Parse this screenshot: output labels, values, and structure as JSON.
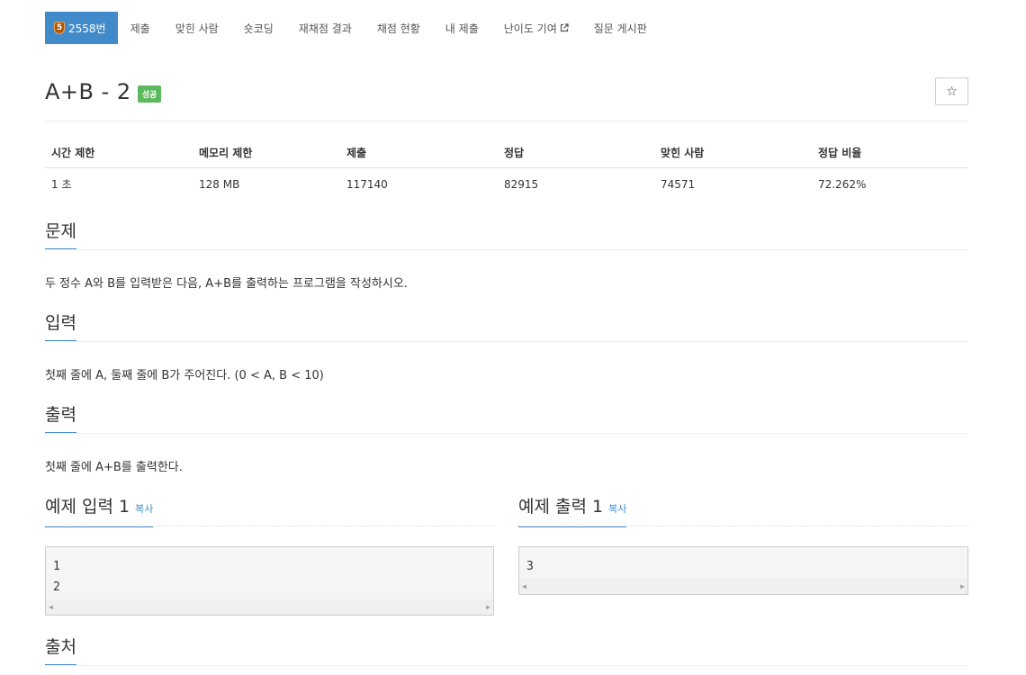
{
  "nav": {
    "problem_tier": "5",
    "problem_number": "2558번",
    "tabs": [
      "제출",
      "맞힌 사람",
      "숏코딩",
      "재채점 결과",
      "채점 현황",
      "내 제출",
      "난이도 기여",
      "질문 게시판"
    ]
  },
  "problem": {
    "title": "A+B - 2",
    "status_badge": "성공",
    "star_icon": "☆"
  },
  "info_table": {
    "headers": [
      "시간 제한",
      "메모리 제한",
      "제출",
      "정답",
      "맞힌 사람",
      "정답 비율"
    ],
    "values": [
      "1 초",
      "128 MB",
      "117140",
      "82915",
      "74571",
      "72.262%"
    ]
  },
  "sections": {
    "description": {
      "heading": "문제",
      "text": "두 정수 A와 B를 입력받은 다음, A+B를 출력하는 프로그램을 작성하시오."
    },
    "input": {
      "heading": "입력",
      "text": "첫째 줄에 A, 둘째 줄에 B가 주어진다. (0 < A, B < 10)"
    },
    "output": {
      "heading": "출력",
      "text": "첫째 줄에 A+B를 출력한다."
    },
    "source": {
      "heading": "출처"
    }
  },
  "samples": {
    "input": {
      "heading": "예제 입력 1",
      "copy_label": "복사",
      "lines": [
        "1",
        "2"
      ]
    },
    "output": {
      "heading": "예제 출력 1",
      "copy_label": "복사",
      "lines": [
        "3"
      ]
    }
  },
  "colors": {
    "accent": "#428bca",
    "success": "#5cb85c"
  }
}
